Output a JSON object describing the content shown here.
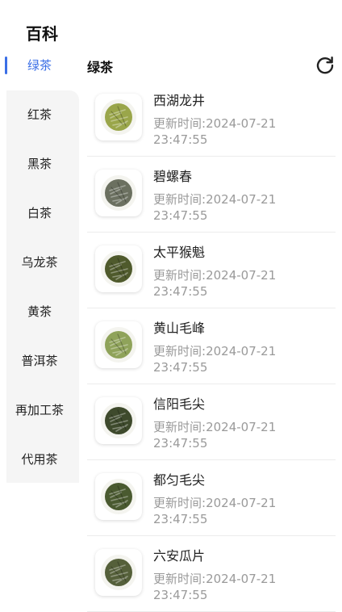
{
  "header": {
    "title": "百科"
  },
  "sidebar": {
    "accent": "#3b6fe6",
    "items": [
      {
        "label": "绿茶",
        "active": true
      },
      {
        "label": "红茶"
      },
      {
        "label": "黑茶"
      },
      {
        "label": "白茶"
      },
      {
        "label": "乌龙茶"
      },
      {
        "label": "黄茶"
      },
      {
        "label": "普洱茶"
      },
      {
        "label": "再加工茶"
      },
      {
        "label": "代用茶"
      }
    ]
  },
  "main": {
    "section_title": "绿茶",
    "refresh_icon": "refresh-icon",
    "time_label": "更新时间:",
    "items": [
      {
        "name": "西湖龙井",
        "date": "2024-07-21",
        "time": "23:47:55",
        "color": "#9aa64a"
      },
      {
        "name": "碧螺春",
        "date": "2024-07-21",
        "time": "23:47:55",
        "color": "#6b7060"
      },
      {
        "name": "太平猴魁",
        "date": "2024-07-21",
        "time": "23:47:55",
        "color": "#4f5a2c"
      },
      {
        "name": "黄山毛峰",
        "date": "2024-07-21",
        "time": "23:47:55",
        "color": "#8fa35a"
      },
      {
        "name": "信阳毛尖",
        "date": "2024-07-21",
        "time": "23:47:55",
        "color": "#3e4a2c"
      },
      {
        "name": "都匀毛尖",
        "date": "2024-07-21",
        "time": "23:47:55",
        "color": "#4a5a30"
      },
      {
        "name": "六安瓜片",
        "date": "2024-07-21",
        "time": "23:47:55",
        "color": "#55603a"
      }
    ]
  }
}
